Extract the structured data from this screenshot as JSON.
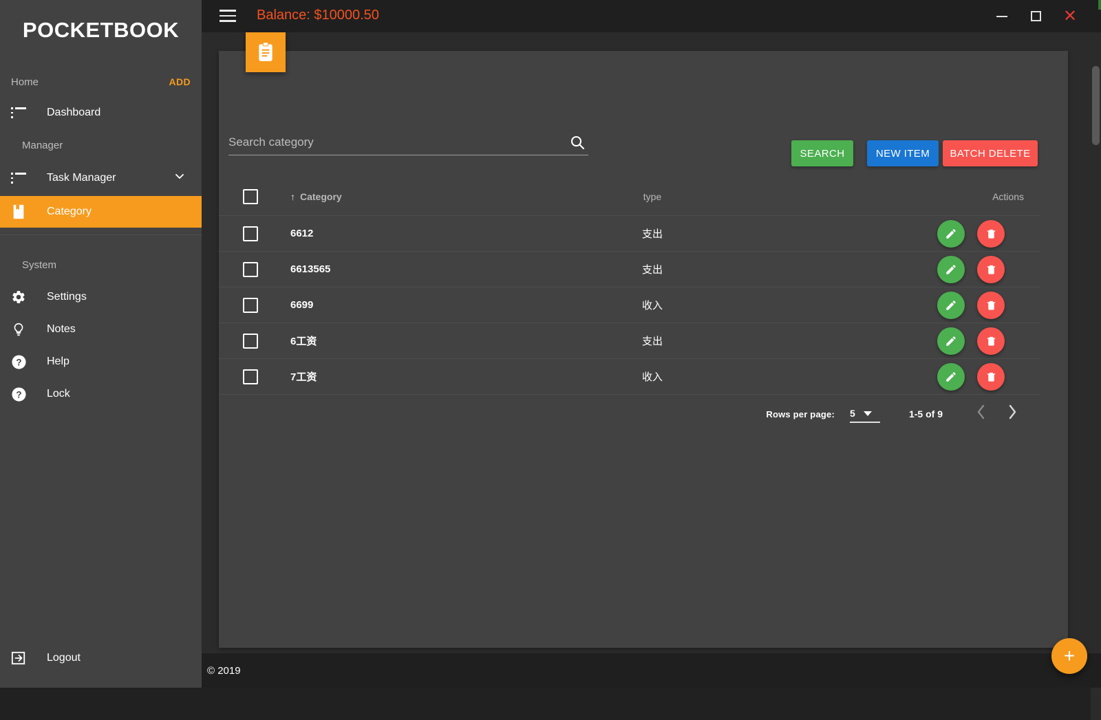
{
  "app": {
    "brand": "POCKETBOOK",
    "copyright": "© 2019"
  },
  "titlebar": {
    "balance": "Balance: $10000.50",
    "menu_icon": "hamburger-icon",
    "minimize": "−",
    "maximize": "□",
    "close": "✕"
  },
  "sidebar": {
    "home_label": "Home",
    "add_label": "ADD",
    "manager_label": "Manager",
    "system_label": "System",
    "items": [
      {
        "label": "Dashboard",
        "icon": "list-icon"
      },
      {
        "label": "Task Manager",
        "icon": "list-icon",
        "expand": "chevron-down-icon"
      },
      {
        "label": "Category",
        "icon": "book-icon",
        "active": true
      },
      {
        "label": "Settings",
        "icon": "gear-icon"
      },
      {
        "label": "Notes",
        "icon": "lightbulb-icon"
      },
      {
        "label": "Help",
        "icon": "question-circle-icon"
      },
      {
        "label": "Lock",
        "icon": "question-circle-icon"
      },
      {
        "label": "Logout",
        "icon": "logout-icon"
      }
    ]
  },
  "card": {
    "badge_icon": "clipboard-icon"
  },
  "search": {
    "placeholder": "Search category",
    "value": "",
    "icon": "search-icon"
  },
  "actions": {
    "search_label": "SEARCH",
    "new_item_label": "NEW ITEM",
    "batch_delete_label": "BATCH DELETE",
    "colors": {
      "search": "#4caf50",
      "new_item": "#1976d2",
      "batch_delete": "#f8544f"
    }
  },
  "table": {
    "columns": [
      "",
      "Category",
      "type",
      "Actions"
    ],
    "sort_indicator": "↑",
    "sorted_column": "Category",
    "rows": [
      {
        "category": "6612",
        "type": "支出"
      },
      {
        "category": "6613565",
        "type": "支出"
      },
      {
        "category": "6699",
        "type": "收入"
      },
      {
        "category": "6工资",
        "type": "支出"
      },
      {
        "category": "7工资",
        "type": "收入"
      }
    ],
    "row_actions": {
      "edit": "pencil-icon",
      "delete": "trash-icon"
    }
  },
  "paginator": {
    "rows_per_page_label": "Rows per page:",
    "rows_per_page_value": "5",
    "range_label": "1-5 of 9",
    "prev_icon": "chevron-left-icon",
    "next_icon": "chevron-right-icon"
  },
  "fab": {
    "label": "+",
    "icon": "plus-icon"
  }
}
